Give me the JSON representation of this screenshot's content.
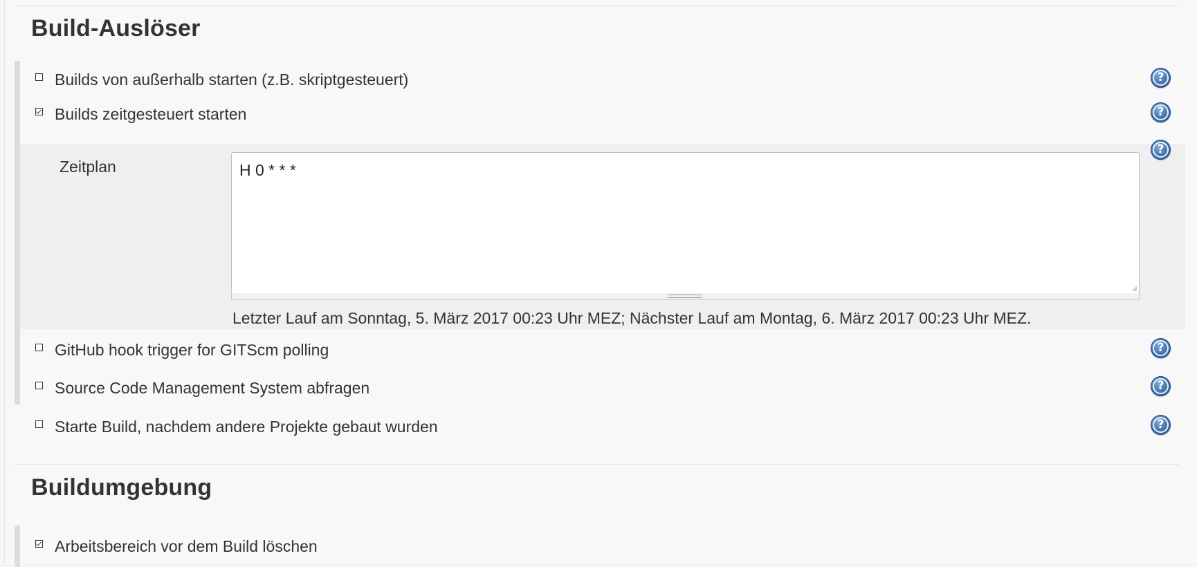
{
  "sections": {
    "build_triggers": {
      "title": "Build-Auslöser",
      "options": [
        {
          "label": "Builds von außerhalb starten (z.B. skriptgesteuert)",
          "checked": false
        },
        {
          "label": "Builds zeitgesteuert starten",
          "checked": true
        },
        {
          "label": "GitHub hook trigger for GITScm polling",
          "checked": false
        },
        {
          "label": "Source Code Management System abfragen",
          "checked": false
        },
        {
          "label": "Starte Build, nachdem andere Projekte gebaut wurden",
          "checked": false
        }
      ],
      "schedule": {
        "label": "Zeitplan",
        "value": "H 0 * * *",
        "hint": "Letzter Lauf am Sonntag, 5. März 2017 00:23 Uhr MEZ; Nächster Lauf am Montag, 6. März 2017 00:23 Uhr MEZ."
      }
    },
    "build_environment": {
      "title": "Buildumgebung",
      "options": [
        {
          "label": "Arbeitsbereich vor dem Build löschen",
          "checked": true
        }
      ]
    }
  },
  "help_icon": {
    "glyph": "?",
    "color": "#3d6fae"
  }
}
